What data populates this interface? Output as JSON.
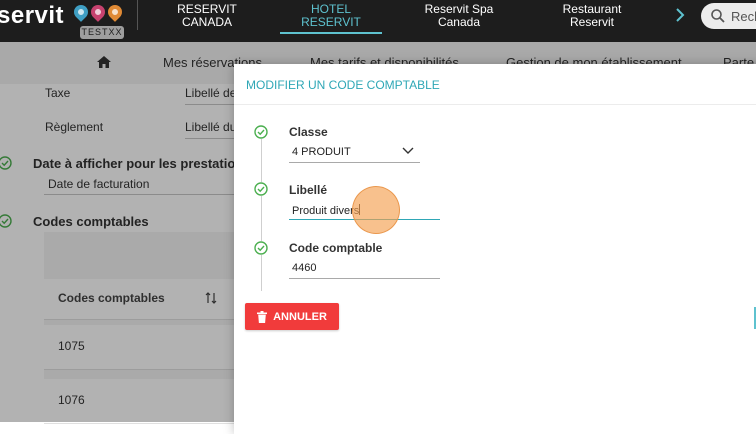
{
  "brand": {
    "logo_text": "servit",
    "badge": "TESTXX",
    "pin_colors": [
      "#3f9fc4",
      "#c7426f",
      "#e08a35"
    ]
  },
  "nav": {
    "tabs": [
      {
        "line1": "RESERVIT",
        "line2": "CANADA"
      },
      {
        "line1": "HOTEL",
        "line2": "RESERVIT"
      },
      {
        "line1": "Reservit Spa",
        "line2": "Canada"
      },
      {
        "line1": "Restaurant",
        "line2": "Reservit"
      }
    ],
    "active_tab": 1,
    "search_text": "Rech"
  },
  "menu": {
    "items": [
      "Mes réservations",
      "Mes tarifs et disponibilités",
      "Gestion de mon établissement",
      "Parte"
    ]
  },
  "background": {
    "taxe_label": "Taxe",
    "taxe_value": "Libellé de",
    "reglement_label": "Règlement",
    "reglement_value": "Libellé du",
    "date_section_title": "Date à afficher pour les prestations",
    "date_value": "Date de facturation",
    "codes_section_title": "Codes comptables",
    "table_header": "Codes comptables",
    "rows": [
      "1075",
      "1076"
    ]
  },
  "modal": {
    "title": "MODIFIER UN CODE COMPTABLE",
    "classe_label": "Classe",
    "classe_value": "4 PRODUIT",
    "libelle_label": "Libellé",
    "libelle_value": "Produit divers",
    "code_label": "Code comptable",
    "code_value": "4460",
    "cancel_label": "ANNULER"
  },
  "colors": {
    "accent": "#2fa7b6",
    "success": "#4caf50",
    "danger": "#f13b3b",
    "topbar": "#1d1d1d"
  }
}
